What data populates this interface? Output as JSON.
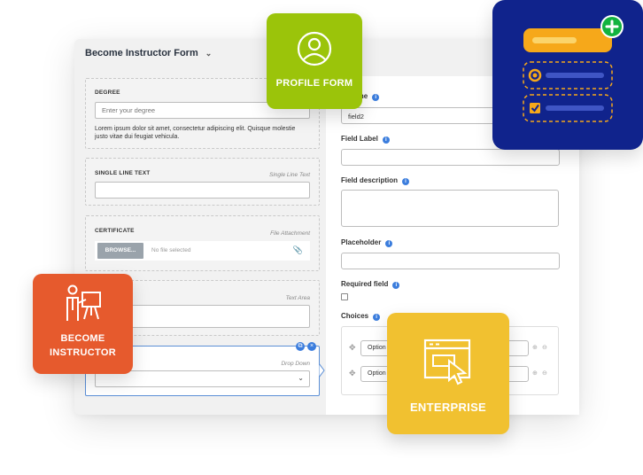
{
  "form": {
    "title": "Become Instructor Form"
  },
  "left_fields": {
    "degree": {
      "title": "DEGREE",
      "placeholder": "Enter your degree",
      "description": "Lorem ipsum dolor sit amet, consectetur adipiscing elit. Quisque molestie justo vitae dui feugiat vehicula."
    },
    "single_line": {
      "title": "SINGLE LINE TEXT",
      "type": "Single Line Text"
    },
    "certificate": {
      "title": "CERTIFICATE",
      "type": "File Attachment",
      "browse_label": "BROWSE...",
      "no_file": "No file selected"
    },
    "text_area": {
      "type": "Text Area"
    },
    "drop_down": {
      "type": "Drop Down"
    }
  },
  "settings": {
    "field_name_label": "lame",
    "field_name_value": "field2",
    "field_label_label": "Field Label",
    "field_description_label": "Field description",
    "placeholder_label": "Placeholder",
    "required_label": "Required field",
    "choices_label": "Choices",
    "choices": [
      "Option",
      "Option"
    ]
  },
  "badges": {
    "profile_form": "PROFILE FORM",
    "become_instructor_line1": "BECOME",
    "become_instructor_line2": "INSTRUCTOR",
    "enterprise": "ENTERPRISE"
  },
  "colors": {
    "profile": "#9bc40a",
    "become": "#e65a2d",
    "enterprise": "#f1c130",
    "blue_card": "#10238c",
    "accent": "#3b7ddd"
  },
  "icons": [
    "user-icon",
    "presenter-icon",
    "browser-cursor-icon",
    "add-icon",
    "checkbox-list-icon",
    "info-icon",
    "paperclip-icon",
    "chevron-down-icon",
    "drag-icon"
  ]
}
